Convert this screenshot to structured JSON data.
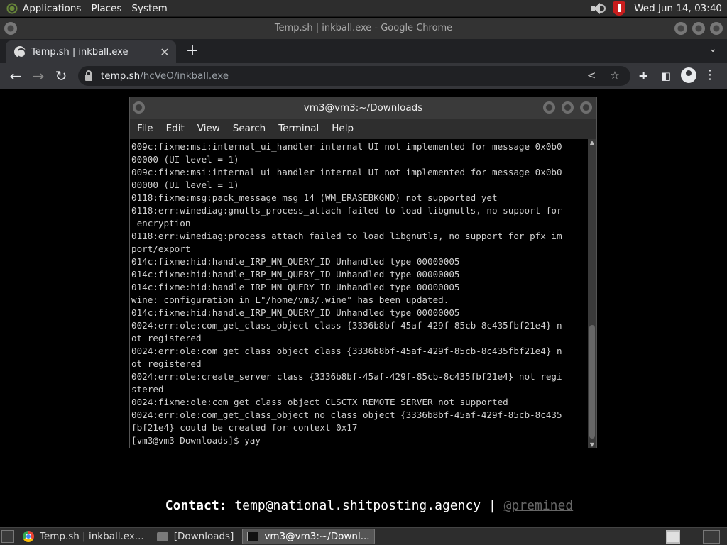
{
  "top_panel": {
    "menus": [
      "Applications",
      "Places",
      "System"
    ],
    "clock": "Wed Jun 14, 03:40"
  },
  "browser": {
    "window_title": "Temp.sh | inkball.exe - Google Chrome",
    "tab_title": "Temp.sh | inkball.exe",
    "url_host": "temp.sh",
    "url_path": "/hcVeO/inkball.exe"
  },
  "terminal": {
    "title": "vm3@vm3:~/Downloads",
    "menu": [
      "File",
      "Edit",
      "View",
      "Search",
      "Terminal",
      "Help"
    ],
    "lines": [
      "009c:fixme:msi:internal_ui_handler internal UI not implemented for message 0x0b0",
      "00000 (UI level = 1)",
      "009c:fixme:msi:internal_ui_handler internal UI not implemented for message 0x0b0",
      "00000 (UI level = 1)",
      "0118:fixme:msg:pack_message msg 14 (WM_ERASEBKGND) not supported yet",
      "0118:err:winediag:gnutls_process_attach failed to load libgnutls, no support for",
      " encryption",
      "0118:err:winediag:process_attach failed to load libgnutls, no support for pfx im",
      "port/export",
      "014c:fixme:hid:handle_IRP_MN_QUERY_ID Unhandled type 00000005",
      "014c:fixme:hid:handle_IRP_MN_QUERY_ID Unhandled type 00000005",
      "014c:fixme:hid:handle_IRP_MN_QUERY_ID Unhandled type 00000005",
      "wine: configuration in L\"/home/vm3/.wine\" has been updated.",
      "014c:fixme:hid:handle_IRP_MN_QUERY_ID Unhandled type 00000005",
      "0024:err:ole:com_get_class_object class {3336b8bf-45af-429f-85cb-8c435fbf21e4} n",
      "ot registered",
      "0024:err:ole:com_get_class_object class {3336b8bf-45af-429f-85cb-8c435fbf21e4} n",
      "ot registered",
      "0024:err:ole:create_server class {3336b8bf-45af-429f-85cb-8c435fbf21e4} not regi",
      "stered",
      "0024:fixme:ole:com_get_class_object CLSCTX_REMOTE_SERVER not supported",
      "0024:err:ole:com_get_class_object no class object {3336b8bf-45af-429f-85cb-8c435",
      "fbf21e4} could be created for context 0x17",
      "[vm3@vm3 Downloads]$ yay -"
    ]
  },
  "footer": {
    "contact_label": "Contact:",
    "contact_email": "temp@national.shitposting.agency",
    "separator": "|",
    "handle": "@premined"
  },
  "taskbar": {
    "items": [
      "Temp.sh | inkball.ex...",
      "[Downloads]",
      "vm3@vm3:~/Downl..."
    ]
  }
}
